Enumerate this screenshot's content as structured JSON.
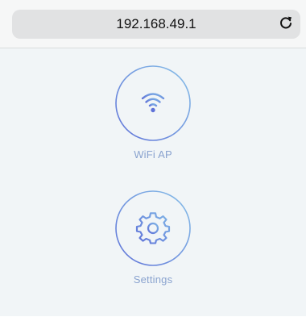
{
  "browser": {
    "url": "192.168.49.1",
    "reload_icon": "reload-icon"
  },
  "menu": {
    "items": [
      {
        "label": "WiFi AP",
        "icon": "wifi-icon"
      },
      {
        "label": "Settings",
        "icon": "gear-icon"
      }
    ]
  },
  "colors": {
    "ring_start": "#5f72d8",
    "ring_end": "#88c0e8",
    "label": "#8aa3cf",
    "background": "#f1f5f7"
  }
}
